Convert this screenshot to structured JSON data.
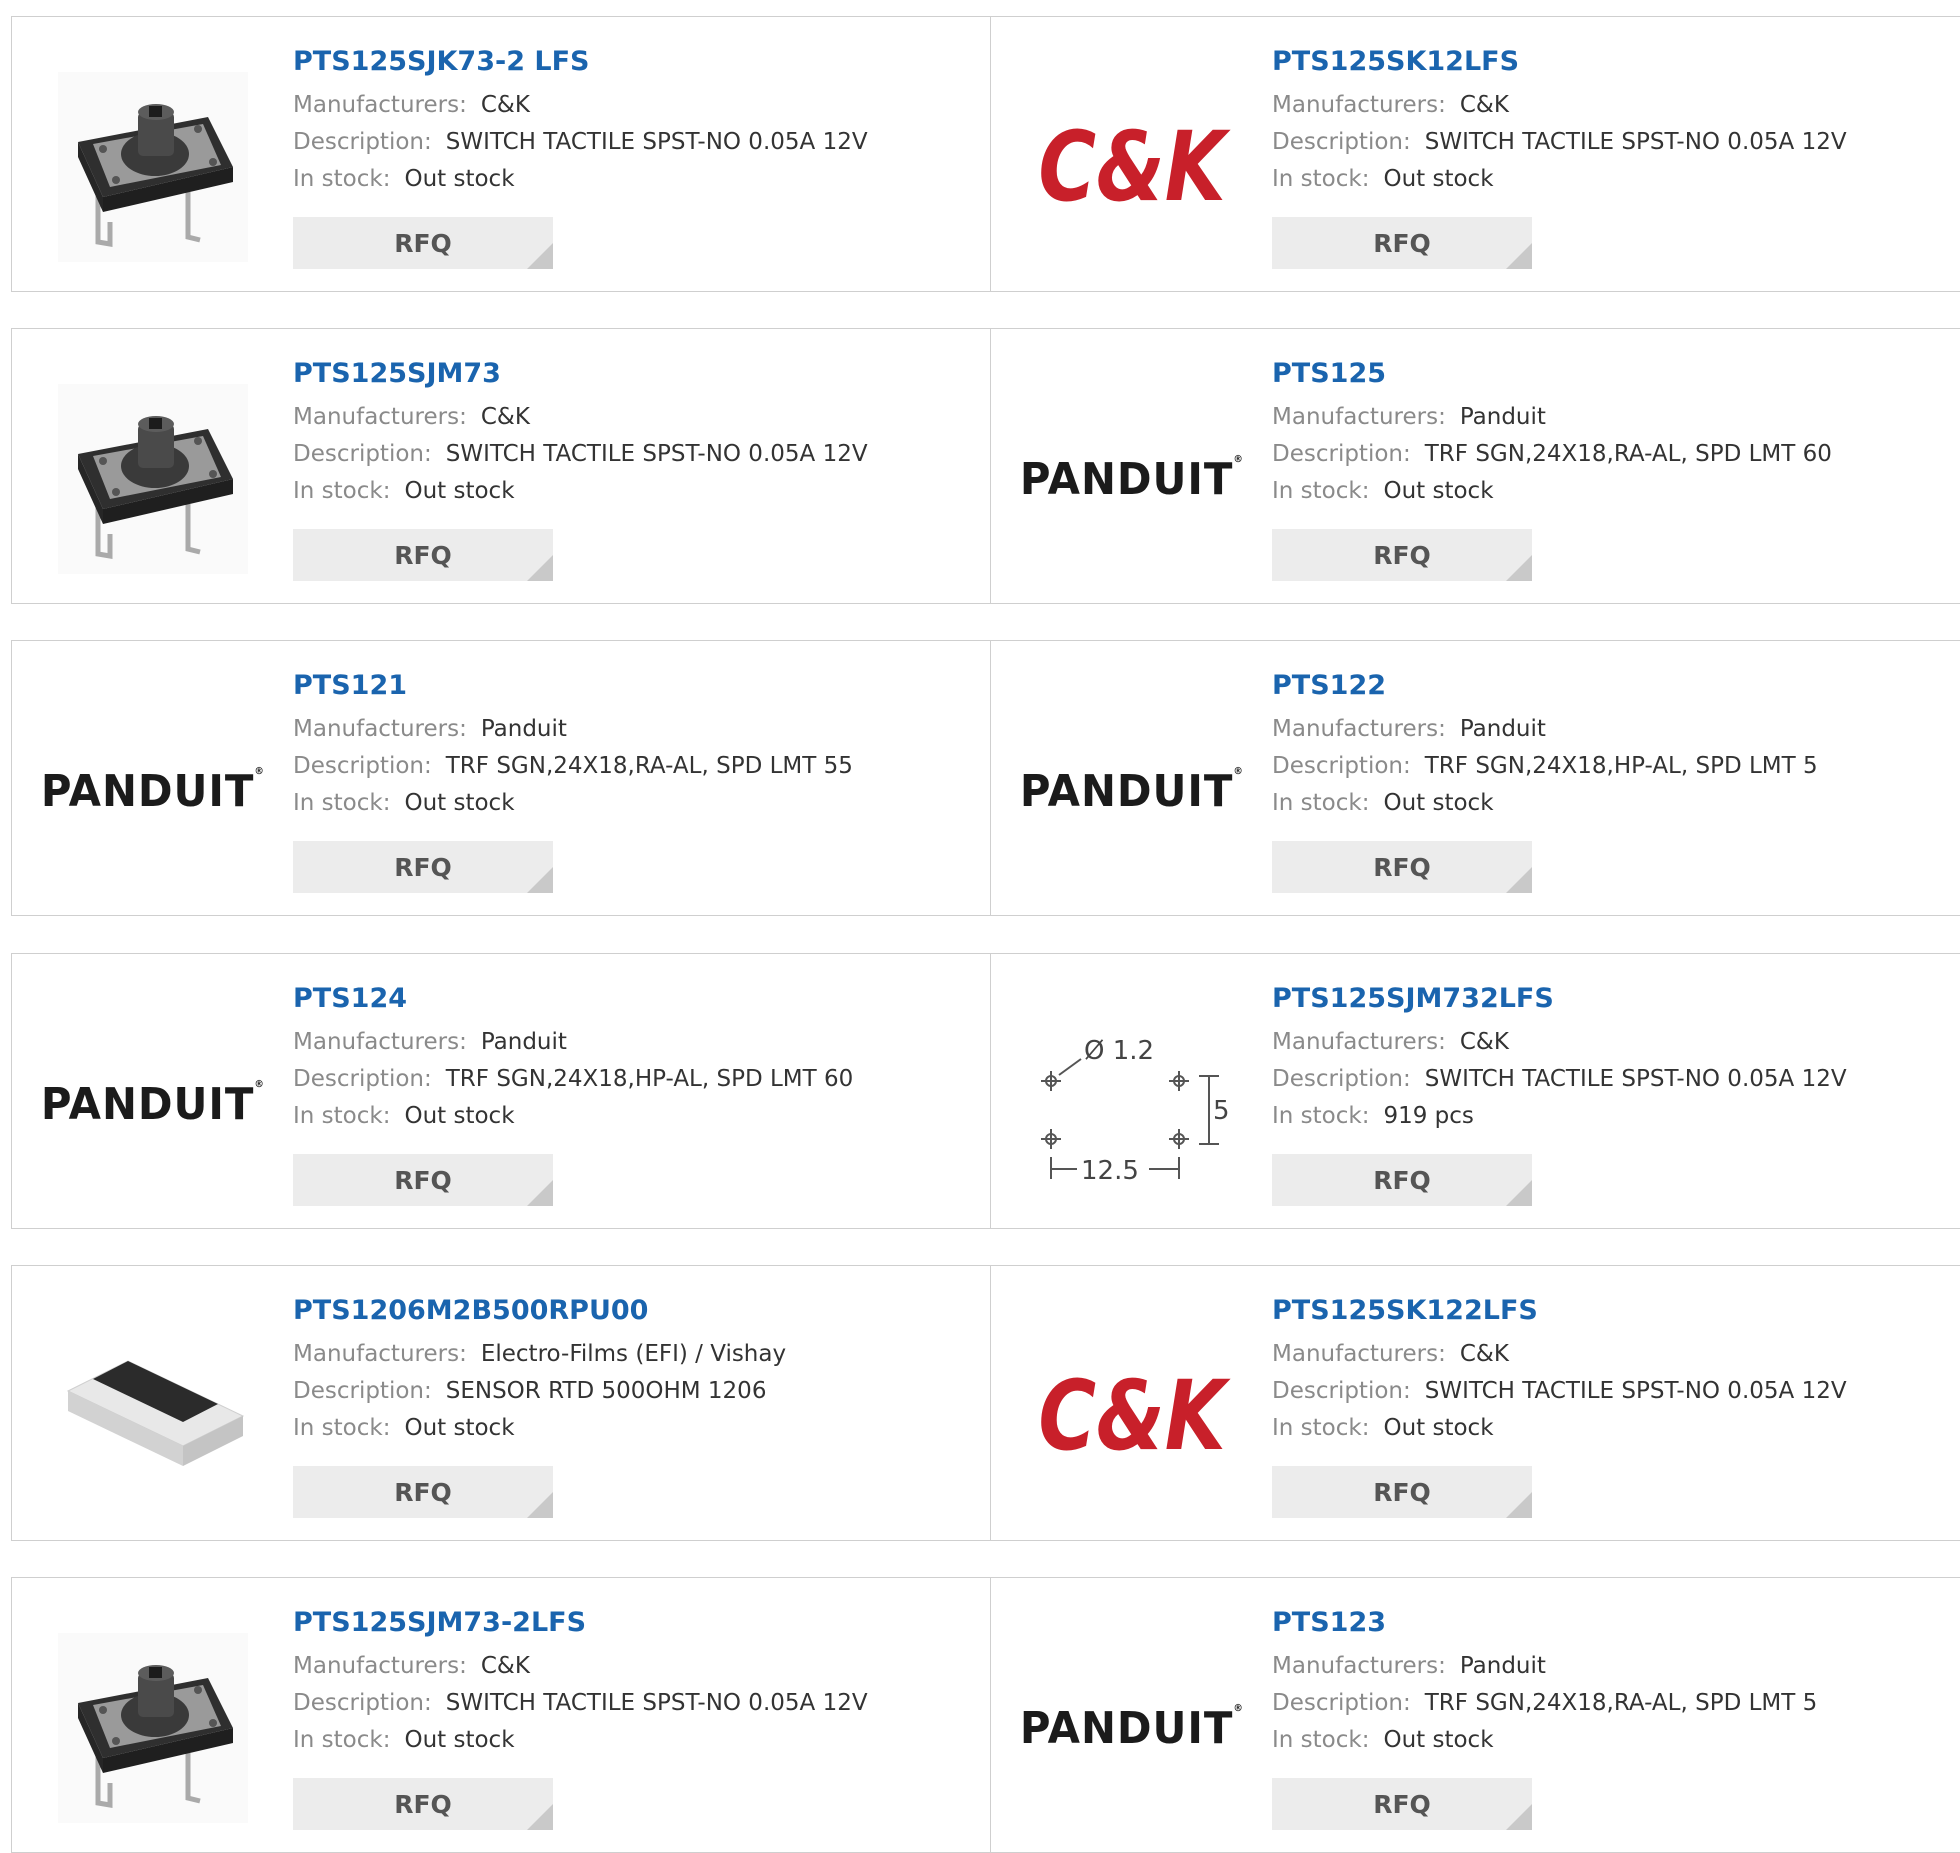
{
  "labels": {
    "manufacturers": "Manufacturers:",
    "description": "Description:",
    "in_stock": "In stock:",
    "rfq": "RFQ"
  },
  "brand_logos": {
    "ck": "C&K",
    "panduit": "PANDUIT"
  },
  "colors": {
    "link": "#1a64ae",
    "ck_red": "#c8202a",
    "rfq_bg": "#ececec"
  },
  "products": [
    {
      "part": "PTS125SJK73-2 LFS",
      "manufacturer": "C&K",
      "description": "SWITCH TACTILE SPST-NO 0.05A 12V",
      "stock": "Out stock",
      "image": "tactile-switch-photo"
    },
    {
      "part": "PTS125SK12LFS",
      "manufacturer": "C&K",
      "description": "SWITCH TACTILE SPST-NO 0.05A 12V",
      "stock": "Out stock",
      "image": "ck-logo"
    },
    {
      "part": "PTS125SJM73",
      "manufacturer": "C&K",
      "description": "SWITCH TACTILE SPST-NO 0.05A 12V",
      "stock": "Out stock",
      "image": "tactile-switch-photo"
    },
    {
      "part": "PTS125",
      "manufacturer": "Panduit",
      "description": "TRF SGN,24X18,RA-AL, SPD LMT 60",
      "stock": "Out stock",
      "image": "panduit-logo"
    },
    {
      "part": "PTS121",
      "manufacturer": "Panduit",
      "description": "TRF SGN,24X18,RA-AL, SPD LMT 55",
      "stock": "Out stock",
      "image": "panduit-logo"
    },
    {
      "part": "PTS122",
      "manufacturer": "Panduit",
      "description": "TRF SGN,24X18,HP-AL, SPD LMT 5",
      "stock": "Out stock",
      "image": "panduit-logo"
    },
    {
      "part": "PTS124",
      "manufacturer": "Panduit",
      "description": "TRF SGN,24X18,HP-AL, SPD LMT 60",
      "stock": "Out stock",
      "image": "panduit-logo"
    },
    {
      "part": "PTS125SJM732LFS",
      "manufacturer": "C&K",
      "description": "SWITCH TACTILE SPST-NO 0.05A 12V",
      "stock": "919 pcs",
      "image": "footprint-drawing"
    },
    {
      "part": "PTS1206M2B500RPU00",
      "manufacturer": "Electro-Films (EFI) / Vishay",
      "description": "SENSOR RTD 500OHM 1206",
      "stock": "Out stock",
      "image": "smd-chip-photo"
    },
    {
      "part": "PTS125SK122LFS",
      "manufacturer": "C&K",
      "description": "SWITCH TACTILE SPST-NO 0.05A 12V",
      "stock": "Out stock",
      "image": "ck-logo"
    },
    {
      "part": "PTS125SJM73-2LFS",
      "manufacturer": "C&K",
      "description": "SWITCH TACTILE SPST-NO 0.05A 12V",
      "stock": "Out stock",
      "image": "tactile-switch-photo"
    },
    {
      "part": "PTS123",
      "manufacturer": "Panduit",
      "description": "TRF SGN,24X18,RA-AL, SPD LMT 5",
      "stock": "Out stock",
      "image": "panduit-logo"
    }
  ],
  "footprint": {
    "hole": "Ø 1.2",
    "height": "5",
    "width": "12.5"
  }
}
